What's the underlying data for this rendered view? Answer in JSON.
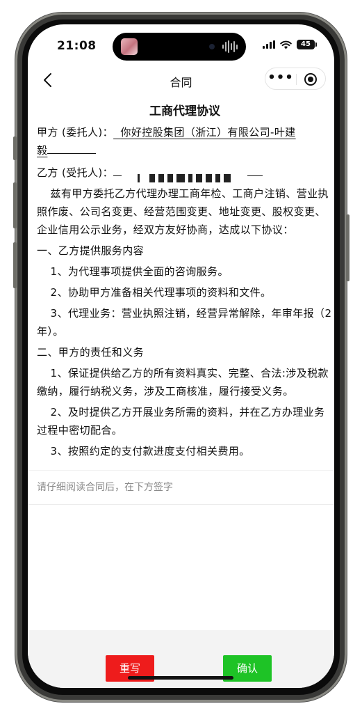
{
  "status_bar": {
    "time": "21:08",
    "battery": "45",
    "icons": [
      "signal-icon",
      "wifi-icon",
      "battery-icon"
    ]
  },
  "nav": {
    "title": "合同",
    "back_icon": "chevron-left-icon",
    "more_icon": "more-dots-icon",
    "close_icon": "target-circle-icon"
  },
  "contract": {
    "title": "工商代理协议",
    "party_a_label": "甲方 (委托人)：",
    "party_a_value_1": "你好控股集团（浙江）有限公司-叶建",
    "party_a_value_2": "毅",
    "party_b_label": "乙方 (受托人)：",
    "paragraphs": [
      {
        "indent": true,
        "text": "兹有甲方委托乙方代理办理工商年检、工商户注销、营业执照作废、公司名变更、经营范围变更、地址变更、股权变更、企业信用公示业务，经双方友好协商，达成以下协议："
      },
      {
        "indent": false,
        "text": "一、乙方提供服务内容"
      },
      {
        "indent": true,
        "text": "1、为代理事项提供全面的咨询服务。"
      },
      {
        "indent": true,
        "text": "2、协助甲方准备相关代理事项的资料和文件。"
      },
      {
        "indent": true,
        "text": "3、代理业务：营业执照注销，经营异常解除，年审年报（2年）。"
      },
      {
        "indent": false,
        "text": "二、甲方的责任和义务"
      },
      {
        "indent": true,
        "text": "1、保证提供给乙方的所有资料真实、完整、合法:涉及税款缴纳，履行纳税义务，涉及工商核准，履行接受义务。"
      },
      {
        "indent": true,
        "text": "2、及时提供乙方开展业务所需的资料，并在乙方办理业务过程中密切配合。"
      },
      {
        "indent": true,
        "text": "3、按照约定的支付款进度支付相关费用。"
      }
    ]
  },
  "sign_hint": "请仔细阅读合同后，在下方签字",
  "buttons": {
    "rewrite": "重写",
    "confirm": "确认"
  },
  "colors": {
    "rewrite_button": "#ee1c1c",
    "confirm_button": "#1ec326",
    "hint_text": "#8a8a8a"
  }
}
